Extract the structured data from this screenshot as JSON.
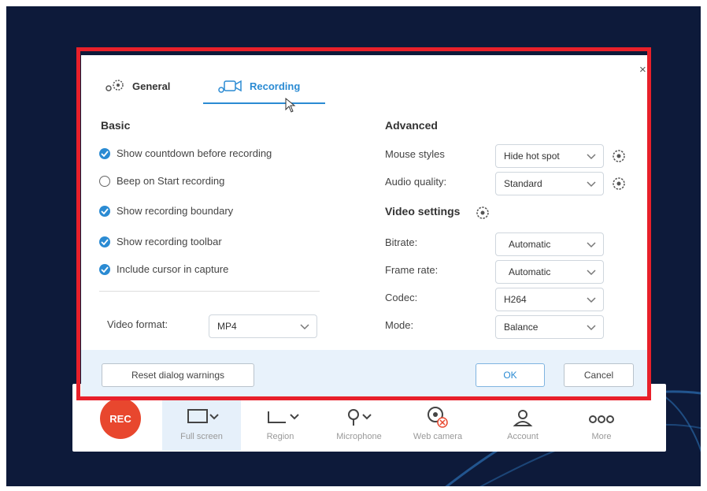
{
  "colors": {
    "accent": "#2b8bd3",
    "highlight": "#e8202a",
    "rec": "#e8472e",
    "desktop": "#0d1a3a"
  },
  "dialog": {
    "close_glyph": "×",
    "tabs": [
      {
        "label": "General",
        "icon": "gears-icon"
      },
      {
        "label": "Recording",
        "icon": "video-camera-icon",
        "active": true
      }
    ],
    "basic": {
      "title": "Basic",
      "options": [
        {
          "label": "Show countdown before recording",
          "checked": true
        },
        {
          "label": "Beep on Start recording",
          "checked": false
        },
        {
          "label": "Show recording boundary",
          "checked": true
        },
        {
          "label": "Show recording toolbar",
          "checked": true
        },
        {
          "label": "Include cursor in capture",
          "checked": true
        }
      ],
      "video_format_label": "Video format:",
      "video_format_value": "MP4"
    },
    "advanced": {
      "title": "Advanced",
      "mouse_styles_label": "Mouse styles",
      "mouse_styles_value": "Hide hot spot",
      "audio_quality_label": "Audio quality:",
      "audio_quality_value": "Standard",
      "video_settings_title": "Video settings",
      "bitrate_label": "Bitrate:",
      "bitrate_value": "Automatic",
      "frame_rate_label": "Frame rate:",
      "frame_rate_value": "Automatic",
      "codec_label": "Codec:",
      "codec_value": "H264",
      "mode_label": "Mode:",
      "mode_value": "Balance"
    },
    "footer": {
      "reset_label": "Reset dialog warnings",
      "ok_label": "OK",
      "cancel_label": "Cancel"
    }
  },
  "toolbar": {
    "rec_label": "REC",
    "items": [
      {
        "label": "Full screen",
        "icon": "monitor-icon",
        "active": true
      },
      {
        "label": "Region",
        "icon": "region-icon"
      },
      {
        "label": "Microphone",
        "icon": "microphone-icon"
      },
      {
        "label": "Web camera",
        "icon": "webcam-off-icon"
      },
      {
        "label": "Account",
        "icon": "account-icon"
      },
      {
        "label": "More",
        "icon": "more-icon"
      }
    ]
  }
}
